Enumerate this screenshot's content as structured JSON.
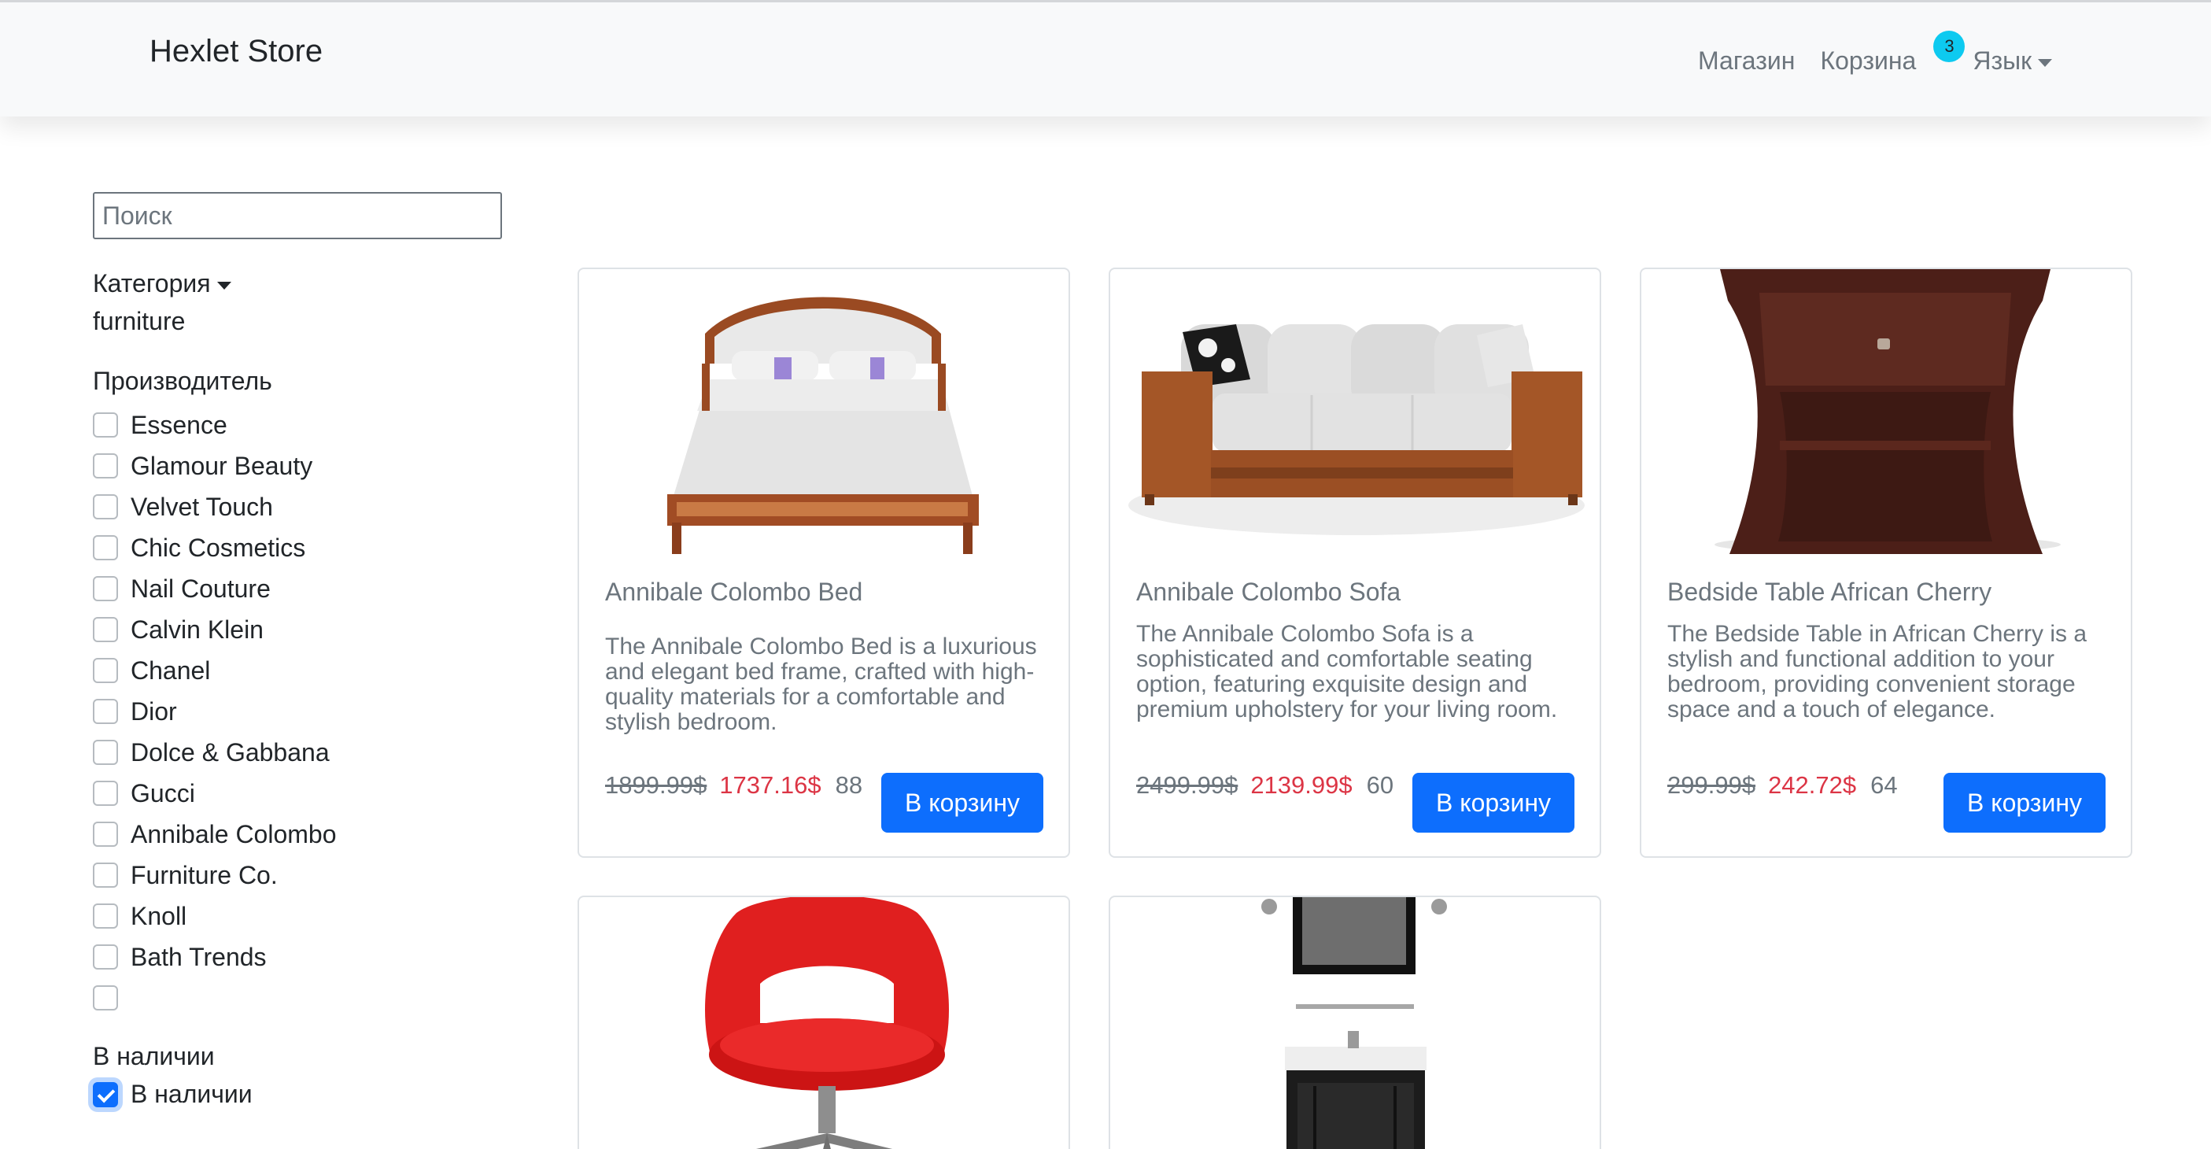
{
  "navbar": {
    "brand": "Hexlet Store",
    "shop_label": "Магазин",
    "cart_label": "Корзина",
    "cart_count": "3",
    "language_label": "Язык"
  },
  "sidebar": {
    "search_placeholder": "Поиск",
    "category_label": "Категория",
    "category_value": "furniture",
    "manufacturer_title": "Производитель",
    "manufacturers": [
      {
        "label": "Essence",
        "checked": false
      },
      {
        "label": "Glamour Beauty",
        "checked": false
      },
      {
        "label": "Velvet Touch",
        "checked": false
      },
      {
        "label": "Chic Cosmetics",
        "checked": false
      },
      {
        "label": "Nail Couture",
        "checked": false
      },
      {
        "label": "Calvin Klein",
        "checked": false
      },
      {
        "label": "Chanel",
        "checked": false
      },
      {
        "label": "Dior",
        "checked": false
      },
      {
        "label": "Dolce & Gabbana",
        "checked": false
      },
      {
        "label": "Gucci",
        "checked": false
      },
      {
        "label": "Annibale Colombo",
        "checked": false
      },
      {
        "label": "Furniture Co.",
        "checked": false
      },
      {
        "label": "Knoll",
        "checked": false
      },
      {
        "label": "Bath Trends",
        "checked": false
      },
      {
        "label": "",
        "checked": false
      }
    ],
    "stock_title": "В наличии",
    "stock_option": {
      "label": "В наличии",
      "checked": true
    }
  },
  "products": [
    {
      "image_icon": "bed-image",
      "title": "Annibale Colombo Bed",
      "description": "The Annibale Colombo Bed is a luxurious and elegant bed frame, crafted with high-quality materials for a comfortable and stylish bedroom.",
      "old_price": "1899.99$",
      "price": "1737.16$",
      "quantity": "88",
      "button": "В корзину"
    },
    {
      "image_icon": "sofa-image",
      "title": "Annibale Colombo Sofa",
      "description": "The Annibale Colombo Sofa is a sophisticated and comfortable seating option, featuring exquisite design and premium upholstery for your living room.",
      "old_price": "2499.99$",
      "price": "2139.99$",
      "quantity": "60",
      "button": "В корзину"
    },
    {
      "image_icon": "bedside-table-image",
      "title": "Bedside Table African Cherry",
      "description": "The Bedside Table in African Cherry is a stylish and functional addition to your bedroom, providing convenient storage space and a touch of elegance.",
      "old_price": "299.99$",
      "price": "242.72$",
      "quantity": "64",
      "button": "В корзину"
    },
    {
      "image_icon": "red-chair-image"
    },
    {
      "image_icon": "bathroom-vanity-image"
    }
  ],
  "colors": {
    "primary": "#0d6efd",
    "sale": "#dc3545",
    "badge": "#0dcaf0",
    "muted": "#6c757d"
  }
}
